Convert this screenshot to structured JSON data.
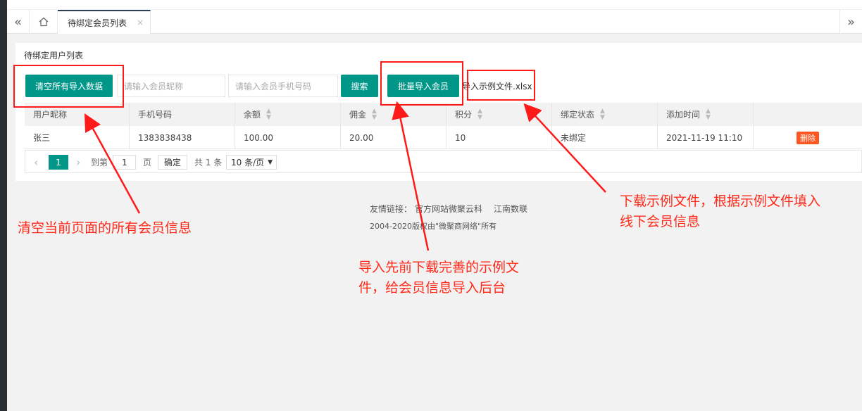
{
  "tabs": {
    "prev_icon": "«",
    "next_icon": "»",
    "active_label": "待绑定会员列表",
    "close_icon": "×"
  },
  "card": {
    "title": "待绑定用户列表"
  },
  "toolbar": {
    "clear_all_label": "清空所有导入数据",
    "nickname_placeholder": "请输入会员昵称",
    "phone_placeholder": "请输入会员手机号码",
    "search_label": "搜索",
    "batch_import_label": "批量导入会员",
    "sample_file_label": "导入示例文件.xlsx"
  },
  "table": {
    "headers": [
      "用户昵称",
      "手机号码",
      "余额",
      "佣金",
      "积分",
      "绑定状态",
      "添加时间",
      ""
    ],
    "sortable": [
      false,
      false,
      true,
      true,
      true,
      true,
      true,
      false
    ],
    "rows": [
      {
        "nickname": "张三",
        "phone": "1383838438",
        "balance": "100.00",
        "commission": "20.00",
        "points": "10",
        "status": "未绑定",
        "added_time": "2021-11-19 11:10",
        "action": "删除"
      }
    ]
  },
  "pager": {
    "prev_icon": "‹",
    "current_page": "1",
    "next_icon": "›",
    "goto_prefix": "到第",
    "goto_value": "1",
    "goto_suffix": "页",
    "confirm_label": "确定",
    "total_text": "共 1 条",
    "page_size": "10 条/页"
  },
  "footer": {
    "links_prefix": "友情链接：",
    "link1": "官方网站微聚云科",
    "link2": "江南数联",
    "copyright": "2004-2020版权由\"微聚商网络\"所有"
  },
  "annotations": {
    "clear_note": "清空当前页面的所有会员信息",
    "import_note_line1": "导入先前下载完善的示例文",
    "import_note_line2": "件，给会员信息导入后台",
    "sample_note_line1": "下载示例文件，根据示例文件填入",
    "sample_note_line2": "线下会员信息"
  },
  "colors": {
    "primary": "#009688",
    "danger": "#ff5722",
    "annotation": "#ff1a1a"
  }
}
